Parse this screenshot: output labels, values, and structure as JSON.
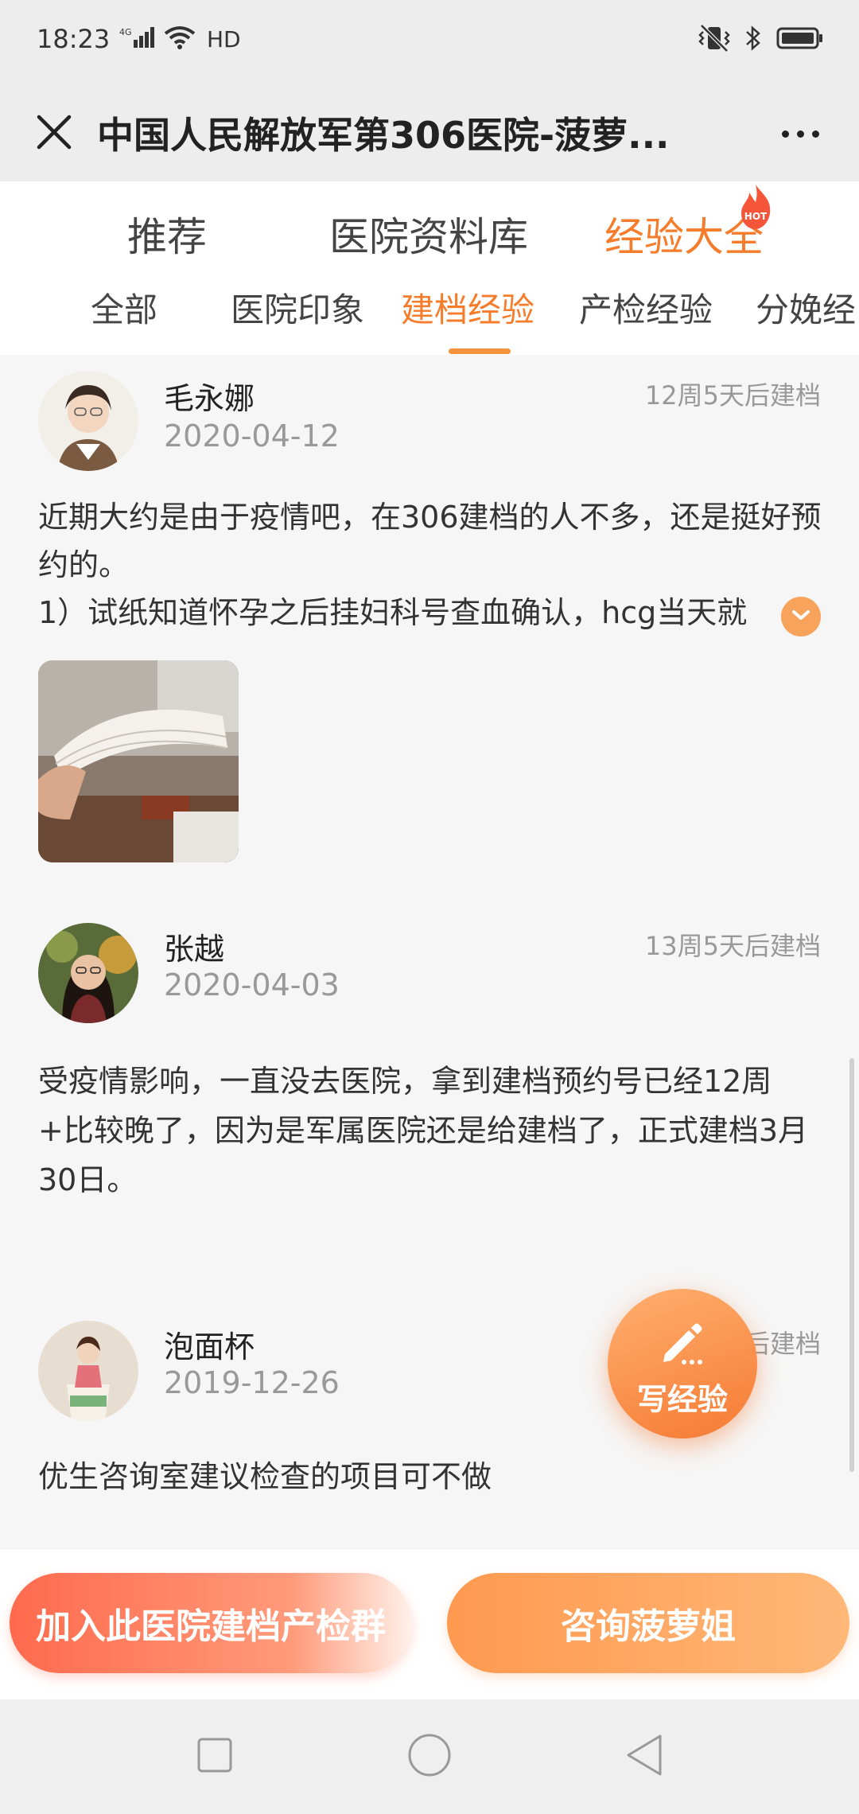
{
  "status_bar": {
    "time": "18:23",
    "network": "4G",
    "hd": "HD",
    "icons": [
      "signal-icon",
      "wifi-icon",
      "vibrate-icon",
      "bluetooth-icon",
      "battery-icon"
    ]
  },
  "app_bar": {
    "title": "中国人民解放军第306医院-菠萝...",
    "close_icon": "close-icon",
    "more_icon": "more-icon"
  },
  "main_tabs": [
    {
      "label": "推荐",
      "active": false
    },
    {
      "label": "医院资料库",
      "active": false
    },
    {
      "label": "经验大全",
      "active": true,
      "badge": "HOT"
    }
  ],
  "sub_tabs": [
    {
      "label": "全部",
      "active": false
    },
    {
      "label": "医院印象",
      "active": false
    },
    {
      "label": "建档经验",
      "active": true
    },
    {
      "label": "产检经验",
      "active": false
    },
    {
      "label": "分娩经",
      "active": false
    }
  ],
  "posts": [
    {
      "user": "毛永娜",
      "date": "2020-04-12",
      "meta": "12周5天后建档",
      "text": "近期大约是由于疫情吧，在306建档的人不多，还是挺好预约的。\n1）试纸知道怀孕之后挂妇科号查血确认，hcg当天就",
      "has_image": true
    },
    {
      "user": "张越",
      "date": "2020-04-03",
      "meta": "13周5天后建档",
      "text": "受疫情影响，一直没去医院，拿到建档预约号已经12周+比较晚了，因为是军属医院还是给建档了，正式建档3月30日。",
      "has_image": false
    },
    {
      "user": "泡面杯",
      "date": "2019-12-26",
      "meta": "后建档",
      "text": "优生咨询室建议检查的项目可不做",
      "has_image": false
    }
  ],
  "fab": {
    "label": "写经验",
    "icon": "pencil-icon"
  },
  "bottom_actions": {
    "join": "加入此医院建档产检群",
    "consult": "咨询菠萝姐"
  },
  "colors": {
    "accent": "#f57c2a",
    "join_gradient_start": "#ff6a4d",
    "consult_gradient_start": "#ff9950"
  }
}
